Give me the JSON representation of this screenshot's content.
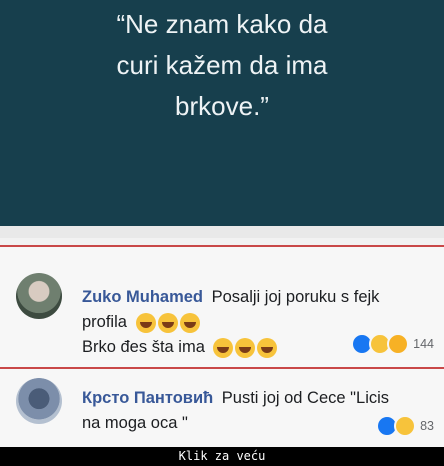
{
  "quote": {
    "lines": [
      "“Ne znam kako da",
      "curi kažem da ima",
      "brkove.”"
    ]
  },
  "comments": [
    {
      "author": "Zuko Muhamed",
      "text_line1": "Posalji joj poruku s fejk",
      "text_line2": "profila",
      "text_line3": "Brko đes šta ima",
      "reaction_count": "144"
    },
    {
      "author": "Крсто Пантовић",
      "text_line1": "Pusti joj od Cece \"Licis",
      "text_line2": "na moga oca \"",
      "reaction_count": "83"
    }
  ],
  "footer": {
    "label": "Klik za veću"
  }
}
